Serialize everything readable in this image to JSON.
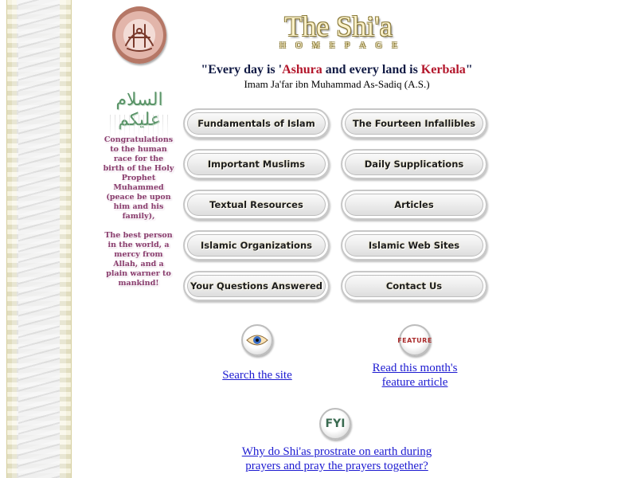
{
  "logo": {
    "title": "The Shi'a",
    "subtitle": [
      "H",
      "O",
      "M",
      "E",
      "P",
      "A",
      "G",
      "E"
    ]
  },
  "quote": {
    "part1": "\"Every day is '",
    "highlight1": "Ashura",
    "part2": " and every land is ",
    "highlight2": "Kerbala",
    "part3": "\"",
    "attribution": "Imam Ja'far ibn Muhammad As-Sadiq (A.S.)",
    "highlight_color": "#b3162b"
  },
  "sidebar": {
    "calligraphy": "السلام عليكم",
    "paragraph1": "Congratulations to the human race for the birth of the Holy Prophet Muhammed (peace be upon him and his family),",
    "paragraph2": "The best person in the world, a mercy from Allah, and a plain warner to mankind!"
  },
  "nav": {
    "fundamentals": "Fundamentals of Islam",
    "infallibles": "The Fourteen Infallibles",
    "important_muslims": "Important Muslims",
    "supplications": "Daily Supplications",
    "textual": "Textual Resources",
    "articles": "Articles",
    "organizations": "Islamic Organizations",
    "web_sites": "Islamic Web Sites",
    "questions": "Your Questions Answered",
    "contact": "Contact Us"
  },
  "links": {
    "search": "Search the site",
    "feature_line1": "Read this month's",
    "feature_line2": "feature article",
    "fyi_line1": "Why do Shi'as prostrate on earth during",
    "fyi_line2": "prayers and pray the prayers together?",
    "feature_badge": "FEATURE",
    "fyi_badge": "FYI"
  },
  "colors": {
    "link": "#1d1bd1",
    "greeting_text": "#8a3e6e",
    "quote_text": "#111a44"
  }
}
